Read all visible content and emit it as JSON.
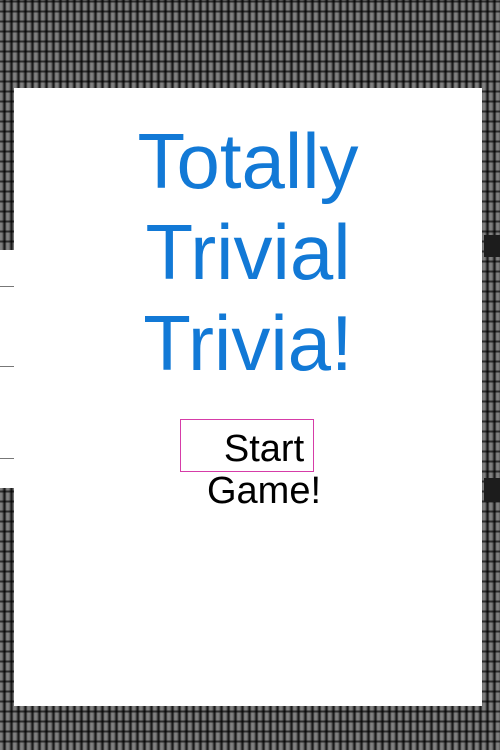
{
  "app": {
    "title_lines": [
      "Totally",
      "Trivial",
      "Trivia!"
    ],
    "start_button": {
      "label_lines": [
        "Start",
        "Game!"
      ]
    }
  },
  "colors": {
    "title": "#1279d6",
    "button_border": "#d63ca8",
    "button_text": "#000000",
    "card_background": "#ffffff"
  }
}
